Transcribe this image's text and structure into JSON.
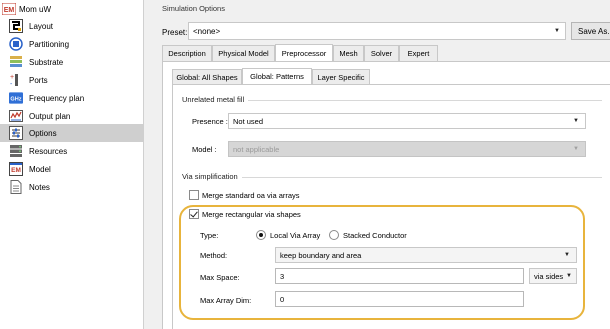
{
  "tree": {
    "root": {
      "label": "Mom uW",
      "icon": "em-icon"
    },
    "items": [
      {
        "label": "Layout",
        "icon": "layout-icon"
      },
      {
        "label": "Partitioning",
        "icon": "partitioning-icon"
      },
      {
        "label": "Substrate",
        "icon": "substrate-icon"
      },
      {
        "label": "Ports",
        "icon": "ports-icon"
      },
      {
        "label": "Frequency plan",
        "icon": "ghz-icon",
        "badge": "GHz"
      },
      {
        "label": "Output plan",
        "icon": "output-plan-icon"
      },
      {
        "label": "Options",
        "icon": "options-icon",
        "selected": true
      },
      {
        "label": "Resources",
        "icon": "resources-icon"
      },
      {
        "label": "Model",
        "icon": "model-icon"
      },
      {
        "label": "Notes",
        "icon": "notes-icon"
      }
    ]
  },
  "section_title": "Simulation Options",
  "preset": {
    "label": "Preset:",
    "value": "<none>",
    "save_as": "Save As..."
  },
  "tabs": [
    "Description",
    "Physical Model",
    "Preprocessor",
    "Mesh",
    "Solver",
    "Expert"
  ],
  "active_tab": "Preprocessor",
  "subtabs": [
    "Global: All Shapes",
    "Global: Patterns",
    "Layer Specific"
  ],
  "active_subtab": "Global: Patterns",
  "unrelated_metal_fill": {
    "title": "Unrelated metal fill",
    "presence_label": "Presence :",
    "presence_value": "Not used",
    "model_label": "Model :",
    "model_value": "not applicable"
  },
  "via_simplification": {
    "title": "Via simplification",
    "merge_standard_label": "Merge standard oa via arrays",
    "merge_standard_checked": false,
    "merge_rect_label": "Merge rectangular via shapes",
    "merge_rect_checked": true,
    "type_label": "Type:",
    "type_options": [
      "Local Via Array",
      "Stacked Conductor"
    ],
    "type_selected": "Local Via Array",
    "method_label": "Method:",
    "method_value": "keep boundary and area",
    "max_space_label": "Max Space:",
    "max_space_value": "3",
    "max_space_unit": "via sides",
    "max_array_dim_label": "Max Array Dim:",
    "max_array_dim_value": "0"
  },
  "colors": {
    "highlight": "#e8b43c",
    "selected_row": "#cfcfcf",
    "em_red": "#c0392b",
    "ghz_blue": "#2f6fd6"
  }
}
